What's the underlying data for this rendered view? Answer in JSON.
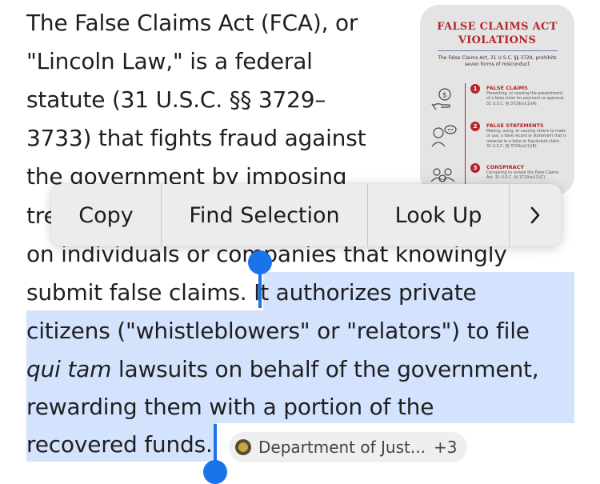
{
  "article": {
    "line1": "The False Claims Act (FCA), or",
    "line2": "\"Lincoln Law,\" is a federal",
    "line3": "statute (31 U.S.C. §§ 3729–",
    "line4": "3733) that fights fraud against",
    "line5": "the government by imposing",
    "line6_start": "tre",
    "line7": "on individuals or companies that knowingly",
    "line8_unselected": "submit false claims. ",
    "line8_selected": "It authorizes private",
    "line9": "citizens (\"whistleblowers\" or \"relators\") to file",
    "line10_italic": "qui tam",
    "line10_rest": " lawsuits on behalf of the government,",
    "line11": "rewarding them with a portion of the",
    "line12": "recovered funds."
  },
  "infographic": {
    "title_line1": "FALSE CLAIMS ACT",
    "title_line2": "VIOLATIONS",
    "subtitle": "The False Claims Act, 31 U.S.C. §§ 3729, prohibits seven forms of misconduct",
    "items": [
      {
        "number": "1",
        "title": "FALSE CLAIMS",
        "desc": "Presenting, or causing the presentment, of a false claim for payment or approval. 31 U.S.C. §§ 3729(a)(1)(A).",
        "icon": "money-hand-icon"
      },
      {
        "number": "2",
        "title": "FALSE STATEMENTS",
        "desc": "Making, using, or causing others to make or use, a false record or statement that is material to a false or fraudulent claim. 31 U.S.C. §§ 3729(a)(1)(B).",
        "icon": "speech-person-icon"
      },
      {
        "number": "3",
        "title": "CONSPIRACY",
        "desc": "Conspiring to violate the False Claims Act. 31 U.S.C. §§ 3729(a)(1)(C).",
        "icon": "group-icon"
      }
    ]
  },
  "context_menu": {
    "copy": "Copy",
    "find_selection": "Find Selection",
    "look_up": "Look Up",
    "more_icon": "chevron-right-icon"
  },
  "source_chip": {
    "label": "Department of Just...",
    "count": "+3",
    "icon": "doj-seal-icon"
  },
  "colors": {
    "selection": "#d3e3fd",
    "handle": "#1a73e8",
    "info_red": "#b3262c"
  }
}
